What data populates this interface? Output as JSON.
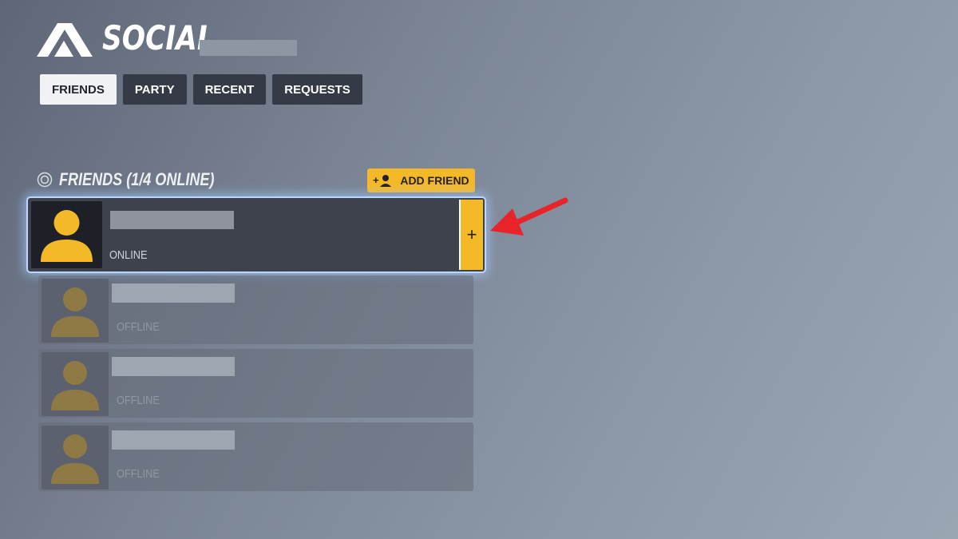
{
  "header": {
    "title": "SOCIAL"
  },
  "tabs": [
    {
      "label": "FRIENDS",
      "active": true
    },
    {
      "label": "PARTY",
      "active": false
    },
    {
      "label": "RECENT",
      "active": false
    },
    {
      "label": "REQUESTS",
      "active": false
    }
  ],
  "friends_section": {
    "title": "FRIENDS (1/4 ONLINE)",
    "add_friend_label": "ADD FRIEND"
  },
  "friends": [
    {
      "status": "ONLINE",
      "selected": true,
      "action": "+"
    },
    {
      "status": "OFFLINE",
      "selected": false
    },
    {
      "status": "OFFLINE",
      "selected": false
    },
    {
      "status": "OFFLINE",
      "selected": false
    }
  ],
  "colors": {
    "accent": "#f4b928",
    "tab_bg": "#343a46",
    "tab_active_bg": "#f1f2f4",
    "arrow": "#e8232a"
  }
}
